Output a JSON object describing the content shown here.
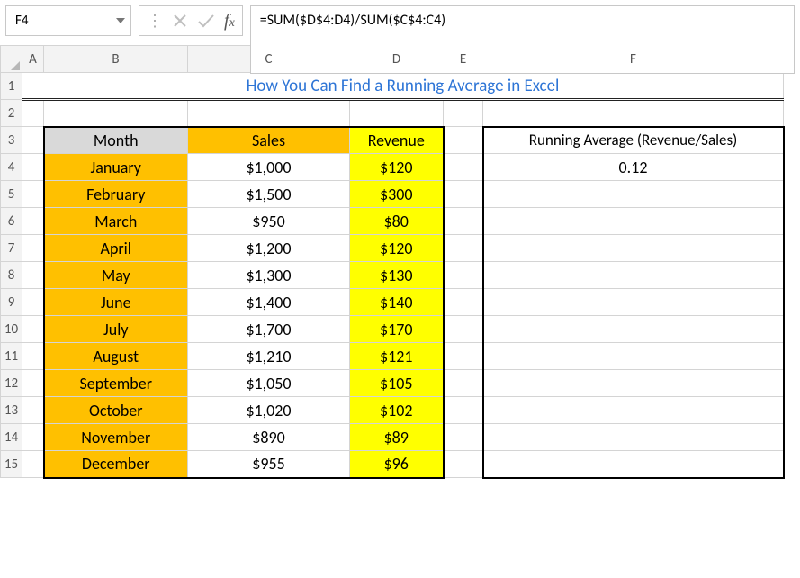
{
  "formula_bar": {
    "cell_ref": "F4",
    "formula": "=SUM($D$4:D4)/SUM($C$4:C4)"
  },
  "columns": {
    "A": "A",
    "B": "B",
    "C": "C",
    "D": "D",
    "E": "E",
    "F": "F"
  },
  "rows": [
    "1",
    "2",
    "3",
    "4",
    "5",
    "6",
    "7",
    "8",
    "9",
    "10",
    "11",
    "12",
    "13",
    "14",
    "15"
  ],
  "title": "How You Can Find a Running Average in Excel",
  "headers": {
    "month": "Month",
    "sales": "Sales",
    "revenue": "Revenue",
    "running": "Running Average (Revenue/Sales)"
  },
  "data": [
    {
      "month": "January",
      "sales": "$1,000",
      "revenue": "$120"
    },
    {
      "month": "February",
      "sales": "$1,500",
      "revenue": "$300"
    },
    {
      "month": "March",
      "sales": "$950",
      "revenue": "$80"
    },
    {
      "month": "April",
      "sales": "$1,200",
      "revenue": "$120"
    },
    {
      "month": "May",
      "sales": "$1,300",
      "revenue": "$130"
    },
    {
      "month": "June",
      "sales": "$1,400",
      "revenue": "$140"
    },
    {
      "month": "July",
      "sales": "$1,700",
      "revenue": "$170"
    },
    {
      "month": "August",
      "sales": "$1,210",
      "revenue": "$121"
    },
    {
      "month": "September",
      "sales": "$1,050",
      "revenue": "$105"
    },
    {
      "month": "October",
      "sales": "$1,020",
      "revenue": "$102"
    },
    {
      "month": "November",
      "sales": "$890",
      "revenue": "$89"
    },
    {
      "month": "December",
      "sales": "$955",
      "revenue": "$96"
    }
  ],
  "running_value": "0.12"
}
